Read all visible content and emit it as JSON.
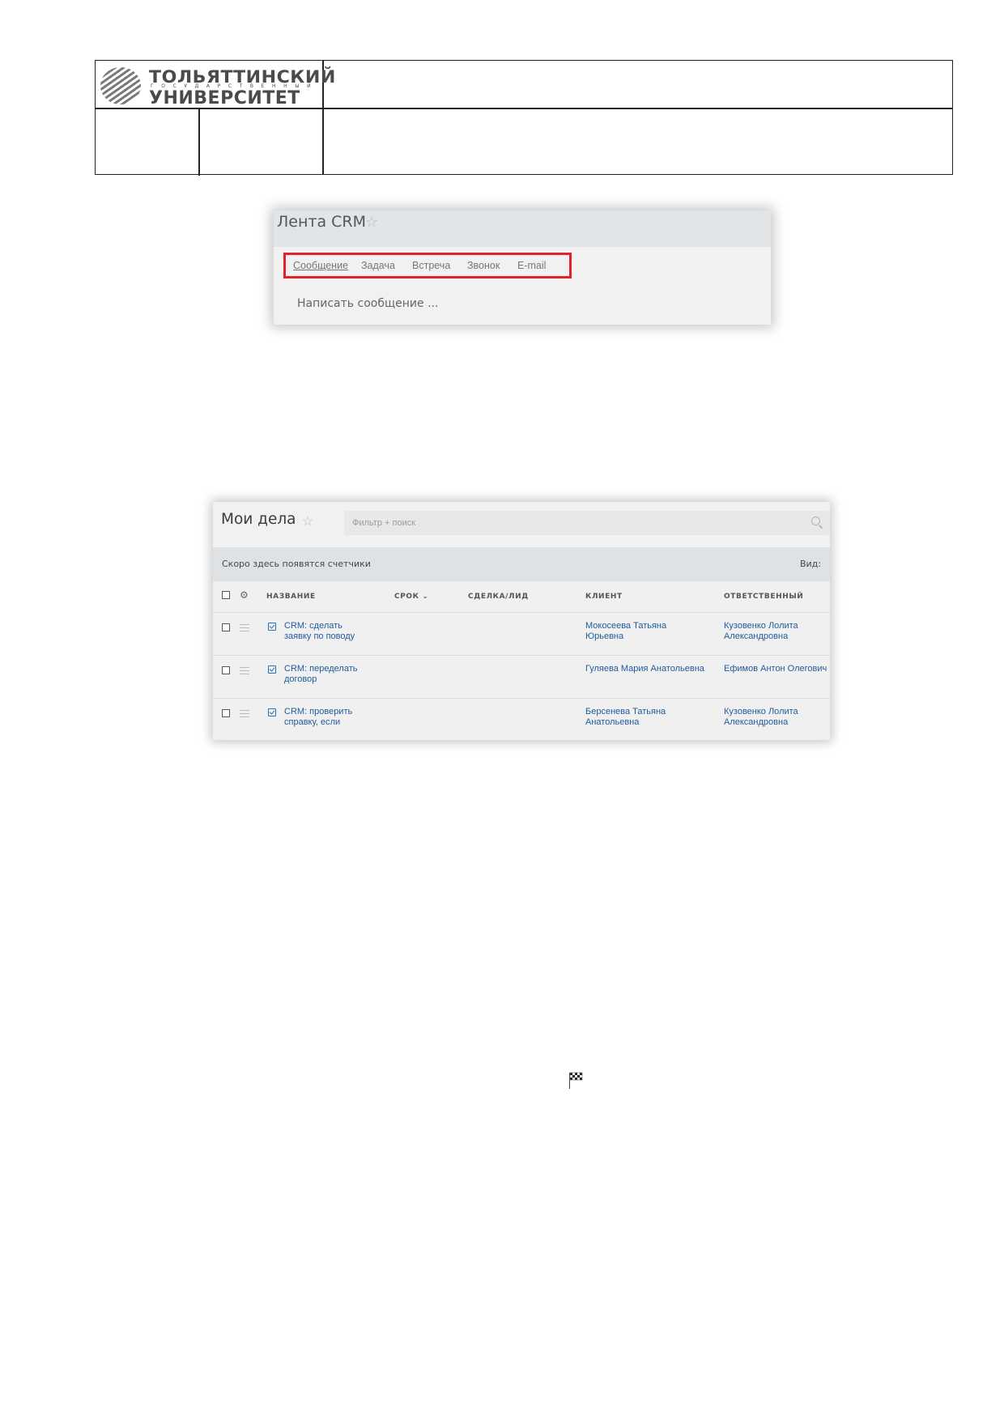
{
  "logo": {
    "line1": "ТОЛЬЯТТИНСКИЙ",
    "line2": "ГОСУДАРСТВЕННЫЙ",
    "line3": "УНИВЕРСИТЕТ"
  },
  "crm_feed": {
    "title": "Лента CRM",
    "star_icon": "star-icon",
    "tabs": [
      "Сообщение",
      "Задача",
      "Встреча",
      "Звонок",
      "E-mail"
    ],
    "active_tab": "Сообщение",
    "compose_placeholder": "Написать сообщение ...",
    "highlight_color": "#e0212e"
  },
  "my_tasks": {
    "title": "Мои дела",
    "search_placeholder": "Фильтр + поиск",
    "counters_text": "Скоро здесь появятся счетчики",
    "view_label": "Вид:",
    "columns": [
      "НАЗВАНИЕ",
      "СРОК",
      "СДЕЛКА/ЛИД",
      "КЛИЕНТ",
      "ОТВЕТСТВЕННЫЙ"
    ],
    "rows": [
      {
        "name": [
          "CRM: сделать",
          "заявку по поводу"
        ],
        "deadline": "",
        "deal": "",
        "client": [
          "Мокосеева Татьяна",
          "Юрьевна"
        ],
        "responsible": [
          "Кузовенко Лолита",
          "Александровна"
        ]
      },
      {
        "name": [
          "CRM: переделать",
          "договор"
        ],
        "deadline": "",
        "deal": "",
        "client": [
          "Гуляева Мария Анатольевна",
          ""
        ],
        "responsible": [
          "Ефимов Антон Олегович",
          ""
        ]
      },
      {
        "name": [
          "CRM: проверить",
          "справку, если"
        ],
        "deadline": "",
        "deal": "",
        "client": [
          "Берсенева Татьяна",
          "Анатольевна"
        ],
        "responsible": [
          "Кузовенко Лолита",
          "Александровна"
        ]
      }
    ],
    "link_color": "#1f5b9c"
  },
  "icons": {
    "flag": "checkered-flag-icon"
  }
}
